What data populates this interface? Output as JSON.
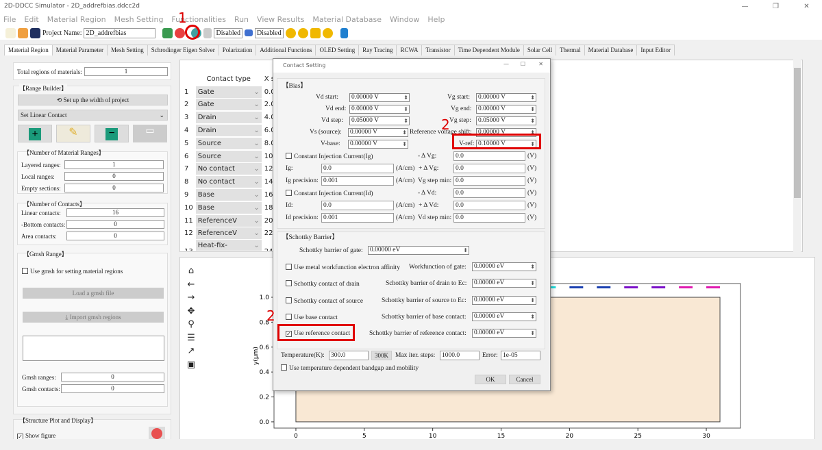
{
  "window": {
    "title": "2D-DDCC Simulator - 2D_addrefbias.ddcc2d",
    "controls": [
      "—",
      "❐",
      "✕"
    ]
  },
  "menu": [
    "File",
    "Edit",
    "Material Region",
    "Mesh Setting",
    "Functionalities",
    "Run",
    "View Results",
    "Material Database",
    "Window",
    "Help"
  ],
  "toolbar": {
    "project_label": "Project Name:",
    "project_name": "2D_addrefbias",
    "disabled1": "Disabled",
    "disabled2": "Disabled"
  },
  "tabs": [
    "Material Region",
    "Material Parameter",
    "Mesh Setting",
    "Schrodinger Eigen Solver",
    "Polarization",
    "Additional Functions",
    "OLED Setting",
    "Ray Tracing",
    "RCWA",
    "Transistor",
    "Time Dependent Module",
    "Solar Cell",
    "Thermal",
    "Material Database",
    "Input Editor"
  ],
  "left": {
    "total_regions_label": "Total regions of materials:",
    "total_regions": "1",
    "range_builder": "【Range Builder】",
    "setup_width": "Set up the width of project",
    "contact_select": "Set Linear Contact",
    "num_ranges_title": "【Number of Material Ranges】",
    "layered_label": "Layered ranges:",
    "layered": "1",
    "local_label": "Local ranges:",
    "local": "0",
    "empty_label": "Empty sections:",
    "empty": "0",
    "num_contacts_title": "【Number of Contacts】",
    "linear_label": "Linear contacts:",
    "linear": "16",
    "bottom_label": "-Bottom contacts:",
    "bottom": "0",
    "area_label": "Area contacts:",
    "area": "0",
    "gmsh_title": "【Gmsh Range】",
    "use_gmsh": "Use gmsh for setting material regions",
    "load_gmsh": "Load a gmsh file",
    "import_gmsh": "Import gmsh regions",
    "gmsh_ranges_label": "Gmsh ranges:",
    "gmsh_ranges": "0",
    "gmsh_contacts_label": "Gmsh contacts:",
    "gmsh_contacts": "0",
    "structure_title": "【Structure Plot and Display】",
    "show_figure": "Show figure"
  },
  "contact_table": {
    "headers": [
      "Contact type",
      "X s"
    ],
    "rows": [
      {
        "n": "1",
        "type": "Gate",
        "x": "0.0"
      },
      {
        "n": "2",
        "type": "Gate",
        "x": "2.0"
      },
      {
        "n": "3",
        "type": "Drain",
        "x": "4.0"
      },
      {
        "n": "4",
        "type": "Drain",
        "x": "6.0"
      },
      {
        "n": "5",
        "type": "Source",
        "x": "8.0"
      },
      {
        "n": "6",
        "type": "Source",
        "x": "10."
      },
      {
        "n": "7",
        "type": "No contact",
        "x": "12."
      },
      {
        "n": "8",
        "type": "No contact",
        "x": "14."
      },
      {
        "n": "9",
        "type": "Base",
        "x": "16."
      },
      {
        "n": "10",
        "type": "Base",
        "x": "18."
      },
      {
        "n": "11",
        "type": "ReferenceV",
        "x": "20."
      },
      {
        "n": "12",
        "type": "ReferenceV",
        "x": "22."
      },
      {
        "n": "13",
        "type": "Heat-fix-boundary",
        "x": "24."
      }
    ]
  },
  "dialog": {
    "title": "Contact Setting",
    "bias_title": "【Bias】",
    "vd_start_label": "Vd start:",
    "vd_start": "0.00000 V",
    "vd_end_label": "Vd end:",
    "vd_end": "0.00000 V",
    "vd_step_label": "Vd step:",
    "vd_step": "0.05000 V",
    "vs_label": "Vs (source):",
    "vs": "0.00000 V",
    "vbase_label": "V-base:",
    "vbase": "0.00000 V",
    "vg_start_label": "Vg start:",
    "vg_start": "0.00000 V",
    "vg_end_label": "Vg end:",
    "vg_end": "0.00000 V",
    "vg_step_label": "Vg step:",
    "vg_step": "0.05000 V",
    "ref_shift_label": "Reference voltage shift:",
    "ref_shift": "0.00000 V",
    "vref_label": "V-ref:",
    "vref": "0.10000 V",
    "ci_ig": "Constant Injection Current(Ig)",
    "ig_label": "Ig:",
    "ig": "0.0",
    "ig_prec_label": "Ig precision:",
    "ig_prec": "0.001",
    "ci_id": "Constant Injection Current(Id)",
    "id_label": "Id:",
    "id": "0.0",
    "id_prec_label": "Id precision:",
    "id_prec": "0.001",
    "acm": "(A/cm)",
    "v_unit": "(V)",
    "mdvg_label": "- Δ Vg:",
    "mdvg": "0.0",
    "pdvg_label": "+ Δ Vg:",
    "pdvg": "0.0",
    "vgmin_label": "Vg step min:",
    "vgmin": "0.0",
    "mdvd_label": "- Δ Vd:",
    "mdvd": "0.0",
    "pdvd_label": "+ Δ Vd:",
    "pdvd": "0.0",
    "vdmin_label": "Vd step min:",
    "vdmin": "0.0",
    "schottky_title": "【Schottky Barrier】",
    "sb_gate_label": "Schottky barrier of gate:",
    "sb_gate": "0.00000 eV",
    "use_wf": "Use metal workfunction  electron affinity",
    "wf_gate_label": "Workfunction of gate:",
    "wf_gate": "0.00000 eV",
    "sc_drain": "Schottky contact of drain",
    "sb_drain_label": "Schottky barrier of drain to Ec:",
    "sb_drain": "0.00000 eV",
    "sc_source": "Schottky contact of source",
    "sb_source_label": "Schottky barrier of source to Ec:",
    "sb_source": "0.00000 eV",
    "use_base": "Use base contact",
    "sb_base_label": "Schottky barrier of base contact:",
    "sb_base": "0.00000 eV",
    "use_ref": "Use reference contact",
    "use_ref_checked": true,
    "sb_ref_label": "Schottky barrier of reference contact:",
    "sb_ref": "0.00000 eV",
    "temp_label": "Temperature(K):",
    "temp": "300.0",
    "btn_300k": "300K",
    "max_iter_label": "Max iter. steps:",
    "max_iter": "1000.0",
    "error_label": "Error:",
    "error": "1e-05",
    "use_temp_dep": "Use temperature dependent bandgap and mobility",
    "ok": "OK",
    "cancel": "Cancel"
  },
  "annotations": {
    "step1": "1",
    "step2a": "2",
    "step2b": "2",
    "accent": "#e00000"
  },
  "chart_data": {
    "type": "structure",
    "ylabel": "y(μm)",
    "xlim": [
      -1.6,
      32.5
    ],
    "ylim": [
      -0.05,
      1.11
    ],
    "xticks": [
      "0",
      "5",
      "10",
      "15",
      "20",
      "25",
      "30"
    ],
    "yticks": [
      "0.0",
      "0.2",
      "0.4",
      "0.6",
      "0.8",
      "1.0"
    ],
    "material": {
      "x": [
        0,
        31
      ],
      "y": [
        0,
        1.0
      ],
      "color": "#f9e8d4"
    },
    "contacts_visible": [
      {
        "x": [
          18,
          19
        ],
        "y": 1.08,
        "color": "#22dddd"
      },
      {
        "x": [
          20,
          21
        ],
        "y": 1.08,
        "color": "#1a3fb0"
      },
      {
        "x": [
          22,
          23
        ],
        "y": 1.08,
        "color": "#1a3fb0"
      },
      {
        "x": [
          24,
          25
        ],
        "y": 1.08,
        "color": "#7a10c8"
      },
      {
        "x": [
          26,
          27
        ],
        "y": 1.08,
        "color": "#7a10c8"
      },
      {
        "x": [
          28,
          29
        ],
        "y": 1.08,
        "color": "#e01ab0"
      },
      {
        "x": [
          30,
          31
        ],
        "y": 1.08,
        "color": "#e01ab0"
      }
    ]
  }
}
